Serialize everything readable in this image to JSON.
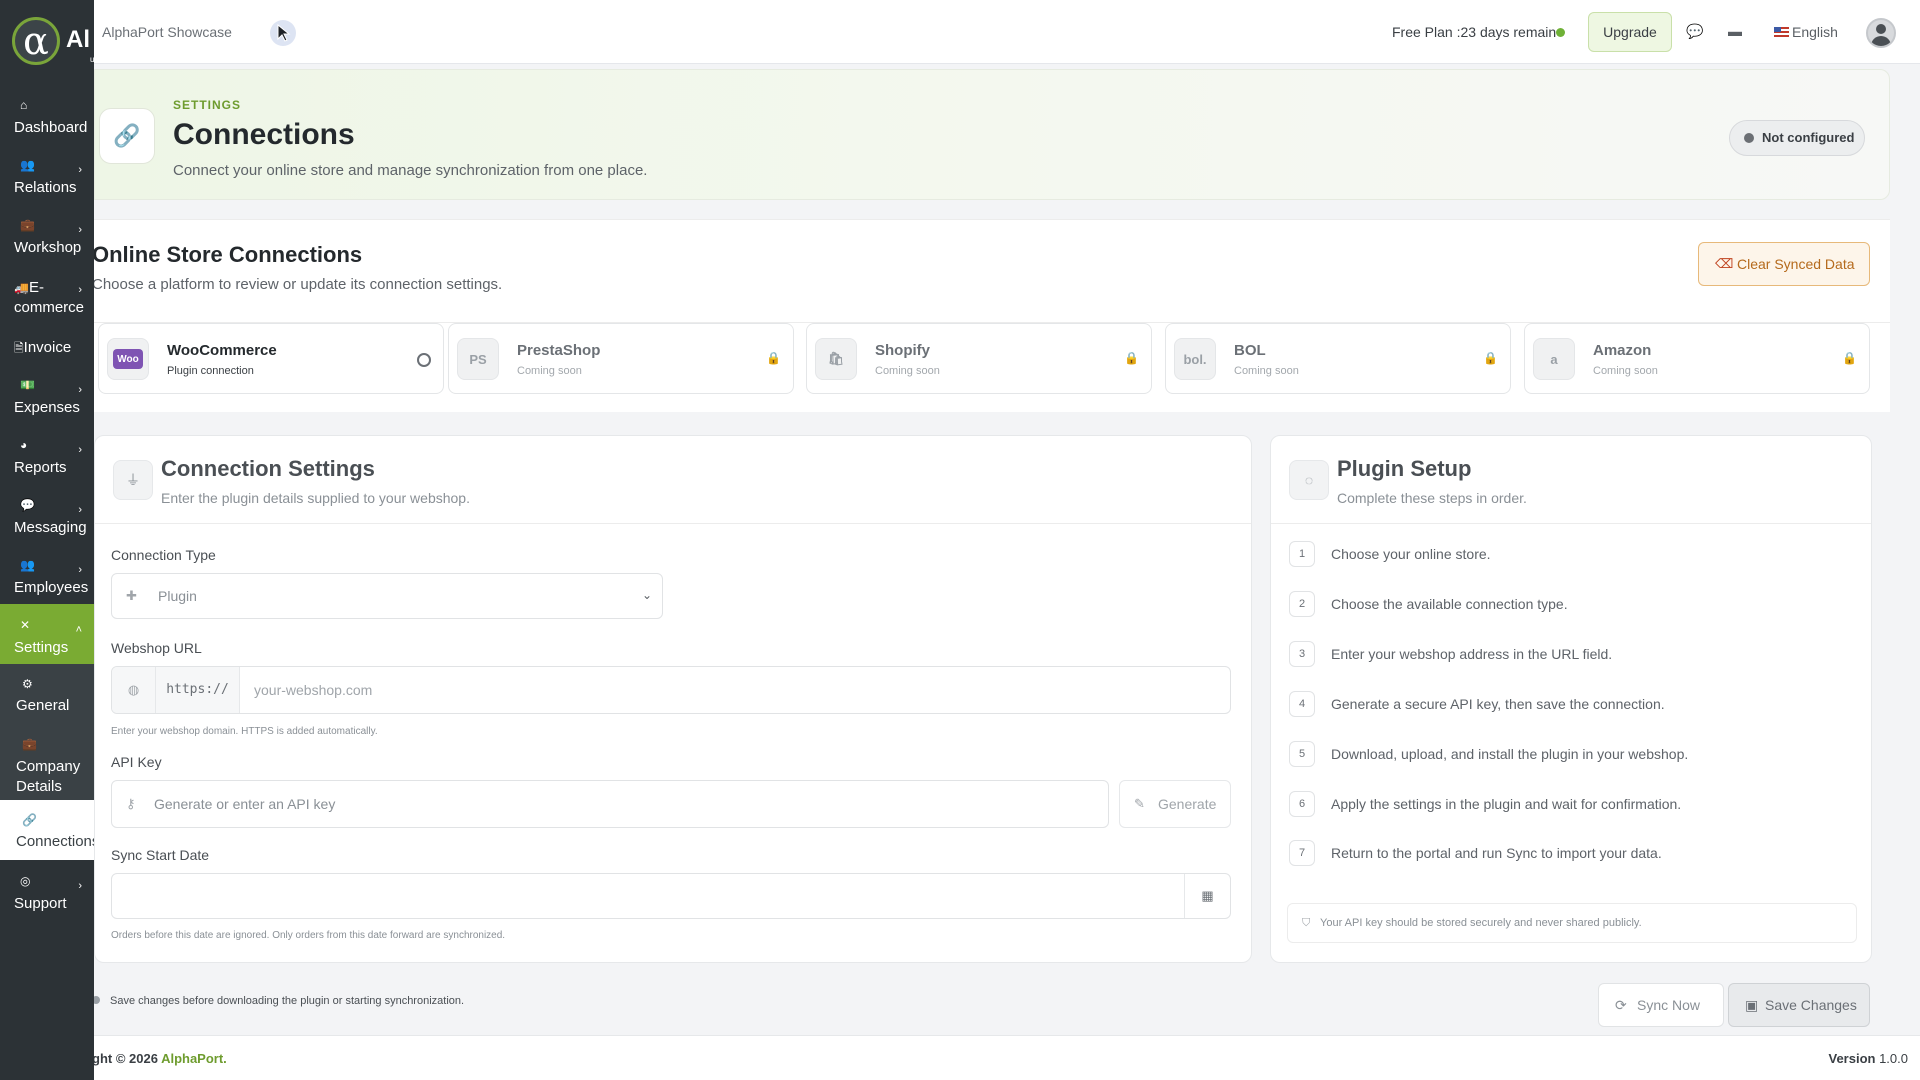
{
  "brand": {
    "logo_glyph": "α",
    "logo_text": "Al",
    "logo_sub": "u"
  },
  "sidebar": {
    "items": [
      {
        "label": "Dashboard",
        "icon": "home-icon",
        "glyph": "⌂"
      },
      {
        "label": "Relations",
        "icon": "users-icon",
        "glyph": "👥"
      },
      {
        "label": "Workshop",
        "icon": "briefcase-icon",
        "glyph": "💼"
      },
      {
        "label": "E-\ncommerce",
        "icon": "truck-icon",
        "glyph": "🚚"
      },
      {
        "label": "Invoice",
        "icon": "file-icon",
        "glyph": "🗎"
      },
      {
        "label": "Expenses",
        "icon": "money-icon",
        "glyph": "💵"
      },
      {
        "label": "Reports",
        "icon": "chart-icon",
        "glyph": "◕"
      },
      {
        "label": "Messaging",
        "icon": "message-icon",
        "glyph": "💬"
      },
      {
        "label": "Employees",
        "icon": "employees-icon",
        "glyph": "👥"
      },
      {
        "label": "Settings",
        "icon": "tools-icon",
        "glyph": "✕"
      },
      {
        "label": "Support",
        "icon": "support-icon",
        "glyph": "◎"
      }
    ],
    "settings_sub": [
      {
        "label": "General",
        "icon": "gear-icon",
        "glyph": "⚙"
      },
      {
        "label": "Company Details",
        "icon": "briefcase-icon",
        "glyph": "💼"
      },
      {
        "label": "Connections",
        "icon": "link-icon",
        "glyph": "🔗"
      }
    ]
  },
  "topbar": {
    "title": "AlphaPort Showcase",
    "plan": "Free Plan :23 days remain",
    "upgrade": "Upgrade",
    "language": "English"
  },
  "hero": {
    "eyebrow": "SETTINGS",
    "title": "Connections",
    "description": "Connect your online store and manage synchronization from one place.",
    "status": "Not configured"
  },
  "stores": {
    "title": "Online Store Connections",
    "subtitle": "Choose a platform to review or update its connection settings.",
    "clear_button": "Clear Synced Data",
    "platforms": [
      {
        "name": "WooCommerce",
        "sub": "Plugin connection",
        "logo": "Woo",
        "selected": true
      },
      {
        "name": "PrestaShop",
        "sub": "Coming soon",
        "logo": "PS",
        "selected": false
      },
      {
        "name": "Shopify",
        "sub": "Coming soon",
        "logo": "🛍",
        "selected": false
      },
      {
        "name": "BOL",
        "sub": "Coming soon",
        "logo": "bol.",
        "selected": false
      },
      {
        "name": "Amazon",
        "sub": "Coming soon",
        "logo": "a",
        "selected": false
      }
    ]
  },
  "connection": {
    "title": "Connection Settings",
    "subtitle": "Enter the plugin details supplied to your webshop.",
    "type_label": "Connection Type",
    "type_value": "Plugin",
    "url_label": "Webshop URL",
    "url_prefix": "https://",
    "url_placeholder": "your-webshop.com",
    "url_help": "Enter your webshop domain. HTTPS is added automatically.",
    "api_label": "API Key",
    "api_placeholder": "Generate or enter an API key",
    "generate": "Generate",
    "date_label": "Sync Start Date",
    "date_help": "Orders before this date are ignored. Only orders from this date forward are synchronized."
  },
  "plugin": {
    "title": "Plugin Setup",
    "subtitle": "Complete these steps in order.",
    "steps": [
      "Choose your online store.",
      "Choose the available connection type.",
      "Enter your webshop address in the URL field.",
      "Generate a secure API key, then save the connection.",
      "Download, upload, and install the plugin in your webshop.",
      "Apply the settings in the plugin and wait for confirmation.",
      "Return to the portal and run Sync to import your data."
    ],
    "note": "Your API key should be stored securely and never shared publicly."
  },
  "actions": {
    "note": "Save changes before downloading the plugin or starting synchronization.",
    "sync": "Sync Now",
    "save": "Save Changes"
  },
  "footer": {
    "copyright_prefix": "ght © 2026 ",
    "brand": "AlphaPort.",
    "version_label": "Version",
    "version": "1.0.0"
  },
  "colors": {
    "accent": "#7aab33",
    "sidebar": "#2c3236",
    "warning": "#b56a1c"
  }
}
